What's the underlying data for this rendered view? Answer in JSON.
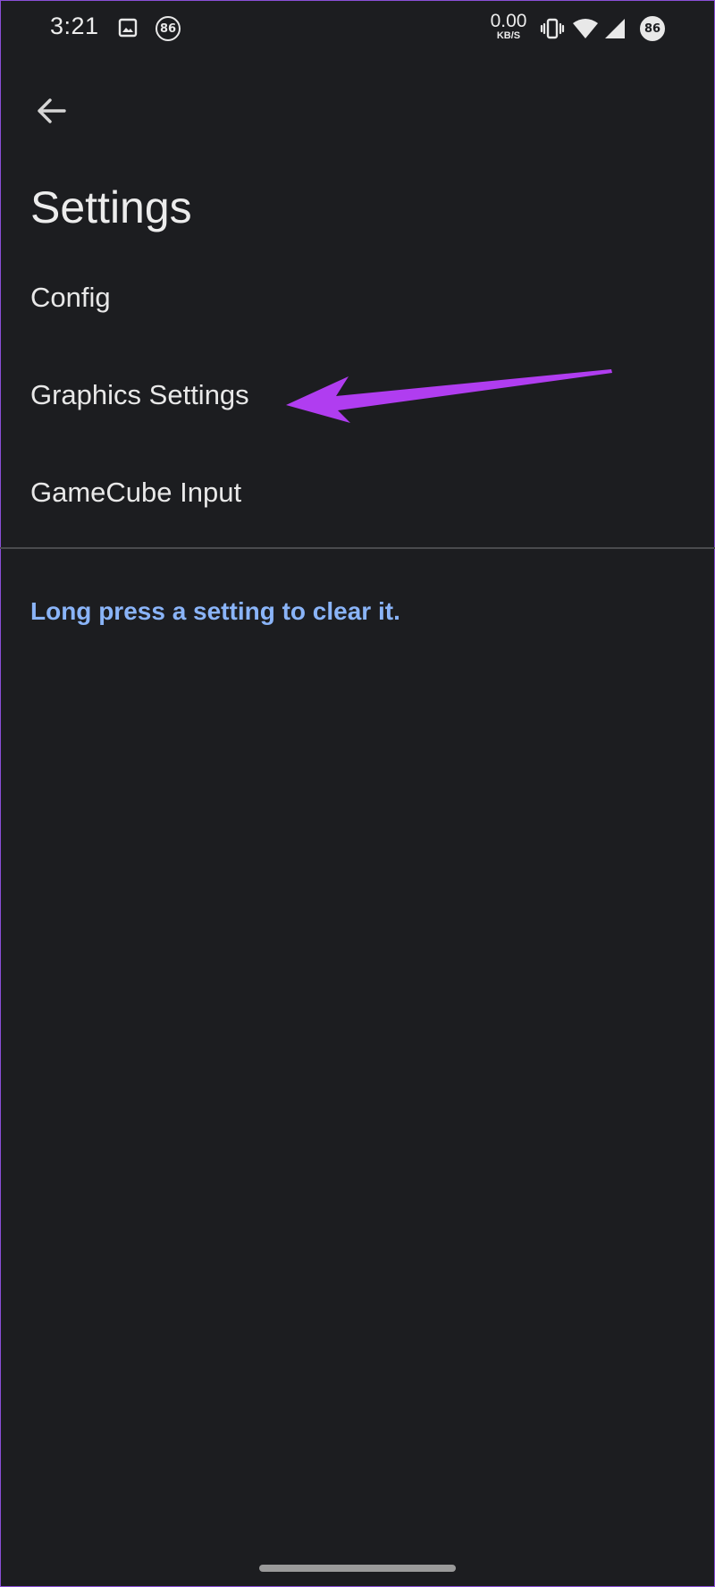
{
  "status_bar": {
    "time": "3:21",
    "notification_badge": "86",
    "network_speed_value": "0.00",
    "network_speed_unit": "KB/S",
    "battery_badge": "86",
    "icons": [
      "gallery-icon",
      "vibrate-icon",
      "wifi-icon",
      "signal-icon"
    ]
  },
  "toolbar": {
    "back_icon": "arrow-left-icon"
  },
  "page": {
    "title": "Settings"
  },
  "settings": {
    "items": [
      {
        "label": "Config"
      },
      {
        "label": "Graphics Settings"
      },
      {
        "label": "GameCube Input"
      }
    ]
  },
  "hint": {
    "text": "Long press a setting to clear it."
  },
  "colors": {
    "background": "#1c1d20",
    "hint": "#8ab4f8",
    "annotation_arrow": "#b03df0"
  }
}
